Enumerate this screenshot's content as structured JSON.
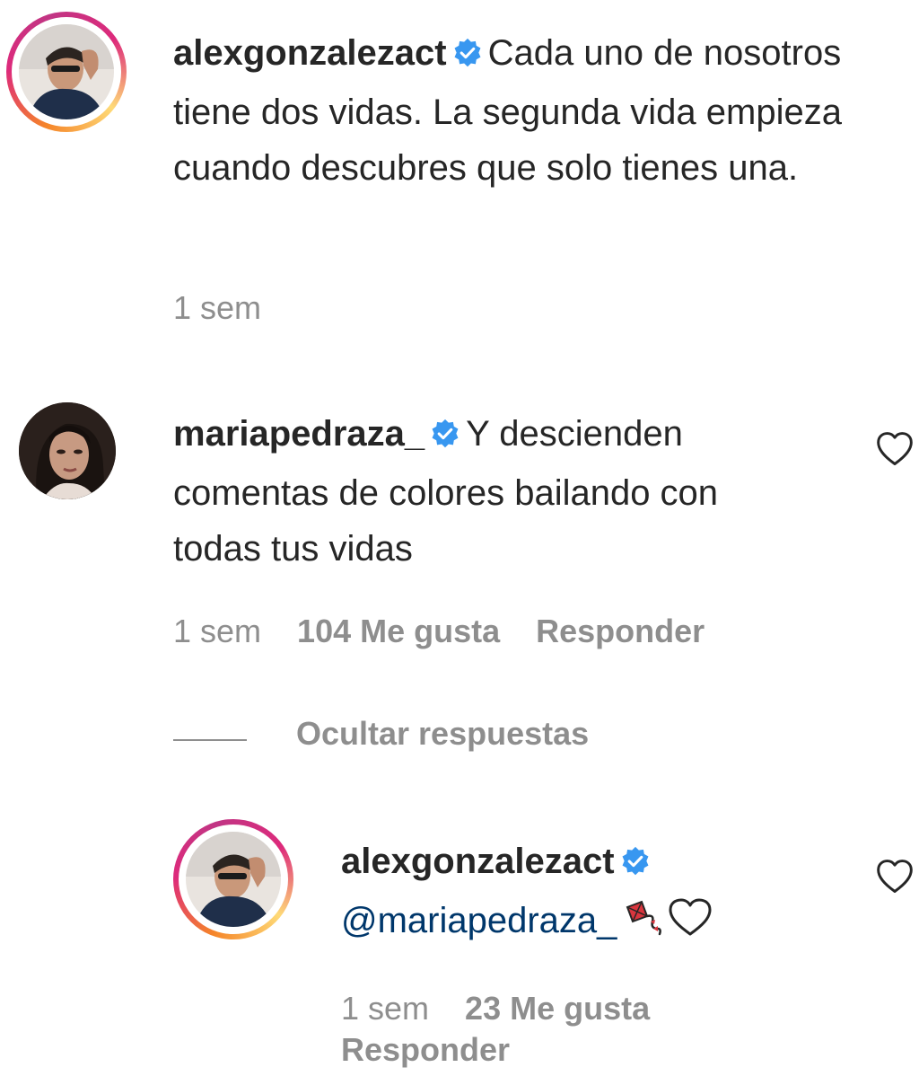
{
  "caption": {
    "username": "alexgonzalezact",
    "text": "Cada uno de nosotros tiene dos vidas. La segunda vida empieza cuando descubres que solo tienes una.",
    "time": "1 sem"
  },
  "comment": {
    "username": "mariapedraza_",
    "text": "Y descienden comentas de colores bailando con todas tus vidas",
    "time": "1 sem",
    "likes": "104 Me gusta",
    "reply": "Responder"
  },
  "hide_replies_label": "Ocultar respuestas",
  "reply": {
    "username": "alexgonzalezact",
    "mention": "@mariapedraza_",
    "time": "1 sem",
    "likes": "23 Me gusta",
    "reply": "Responder"
  },
  "colors": {
    "verified": "#3897f0",
    "meta_text": "#8e8e8e",
    "mention": "#00376b",
    "kite_red": "#d9363e"
  },
  "icons": [
    "verified-icon",
    "heart-icon",
    "kite-emoji",
    "white-heart-emoji"
  ]
}
